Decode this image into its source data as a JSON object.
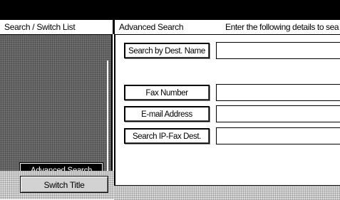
{
  "left_panel": {
    "header": "Search / Switch List",
    "advanced_search_label": "Advanced Search",
    "switch_title_label": "Switch Title"
  },
  "main": {
    "title": "Advanced Search",
    "instruction": "Enter the following details to sea",
    "search_by_dest_name_label": "Search by Dest. Name",
    "fax_number_label": "Fax Number",
    "email_address_label": "E-mail Address",
    "search_ipfax_label": "Search IP-Fax Dest.",
    "fields": {
      "dest_name": "",
      "fax_number": "",
      "email_address": "",
      "ipfax_dest": ""
    }
  },
  "colors": {
    "topbar": "#000000",
    "panel_dark": "#6f6f6f",
    "panel_light": "#d8d8d8"
  }
}
